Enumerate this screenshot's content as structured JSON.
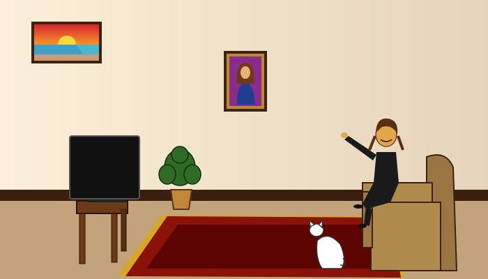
{
  "scene": {
    "colors": {
      "wall_left": "#fcefd9",
      "wall_right": "#e6d3bb",
      "baseboard": "#3b1f0e",
      "floor": "#c3a37c",
      "rug": "#8b1208",
      "rug_inner": "#5c0503",
      "rug_fringe": "#d4a62a",
      "chair": "#b0894d",
      "table": "#6b3a17",
      "tv": "#111111",
      "cat": "#ffffff",
      "girl_clothes": "#1a1a1a",
      "skin": "#e0a64a"
    },
    "objects": [
      "sunset-painting",
      "portrait-painting",
      "television",
      "side-table",
      "potted-plant",
      "rug",
      "armchair",
      "girl",
      "cat"
    ]
  }
}
